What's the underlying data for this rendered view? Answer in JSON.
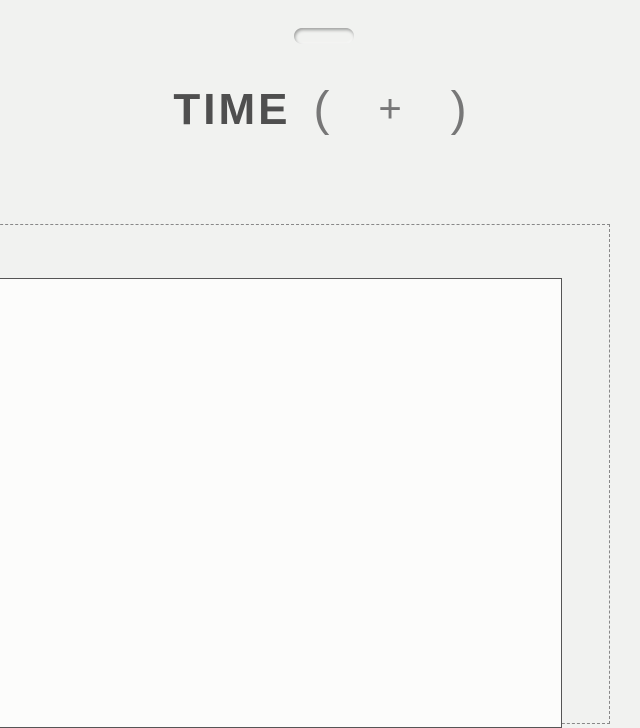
{
  "title": {
    "word": "TIME",
    "open_paren": "(",
    "plus": "+",
    "close_paren": ")"
  }
}
